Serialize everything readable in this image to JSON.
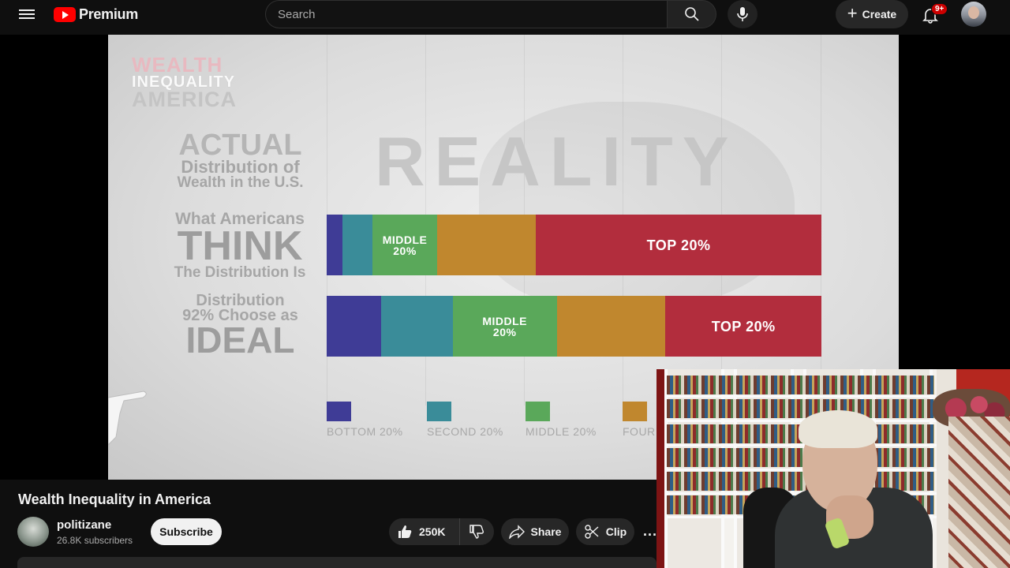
{
  "header": {
    "brand": "Premium",
    "search_placeholder": "Search",
    "create_label": "Create",
    "notification_badge": "9+"
  },
  "video_frame": {
    "wordmark": [
      "WEALTH",
      "INEQUALITY",
      "AMERICA"
    ],
    "big_word": "REALITY",
    "row_labels": {
      "actual": [
        "ACTUAL",
        "Distribution of",
        "Wealth in the U.S."
      ],
      "think": [
        "What Americans",
        "THINK",
        "The Distribution Is"
      ],
      "ideal": [
        "Distribution",
        "92% Choose as",
        "IDEAL"
      ]
    },
    "chart_data": {
      "type": "bar",
      "categories": [
        "BOTTOM 20%",
        "SECOND 20%",
        "MIDDLE 20%",
        "FOURTH 20%",
        "TOP 20%"
      ],
      "series": [
        {
          "name": "What Americans THINK The Distribution Is",
          "values": [
            3.2,
            6.1,
            13.0,
            20.0,
            57.7
          ],
          "segment_labels": [
            "",
            "",
            "MIDDLE\n20%",
            "",
            "TOP 20%"
          ]
        },
        {
          "name": "Distribution 92% Choose as IDEAL",
          "values": [
            11.0,
            14.5,
            21.0,
            22.0,
            31.5
          ],
          "segment_labels": [
            "",
            "",
            "MIDDLE\n20%",
            "",
            "TOP 20%"
          ]
        }
      ],
      "unit": "percent of total wealth (stacked)",
      "colors": [
        "#3f3c96",
        "#3a8c99",
        "#5aa85a",
        "#c0872e",
        "#b22d3d"
      ],
      "legend": [
        "BOTTOM 20%",
        "SECOND 20%",
        "MIDDLE 20%",
        "FOUR"
      ]
    }
  },
  "video_info": {
    "title": "Wealth Inequality in America",
    "channel": "politizane",
    "subscribers": "26.8K subscribers",
    "subscribe_label": "Subscribe",
    "likes": "250K",
    "share_label": "Share",
    "clip_label": "Clip",
    "more_label": "..."
  },
  "icons": {
    "menu": "menu-icon",
    "search": "search-icon",
    "mic": "mic-icon",
    "notifications": "bell-icon",
    "like": "thumbs-up-icon",
    "dislike": "thumbs-down-icon",
    "share": "share-arrow-icon",
    "clip": "scissors-icon"
  }
}
